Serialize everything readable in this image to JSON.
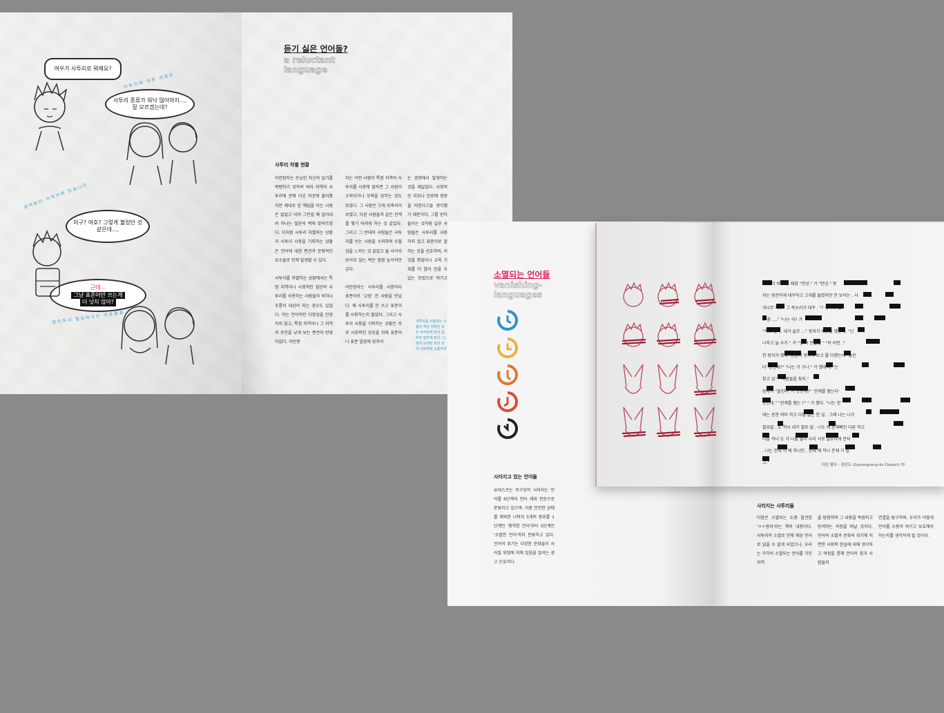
{
  "spread1": {
    "bubbles": {
      "q1": "여우가 사투리로 뭐예요?",
      "q2": "사투리 종류가 워낙 많아야지..., 잘 모르겠는데?",
      "q3": "미구? 여호? 그렇게 불렀던 것 같은데...,",
      "q4_red": "근데...",
      "q4_l1": "그냥 표준어만 쓰는게",
      "q4_l2": "더 낫지 않아?"
    },
    "arcs": {
      "a1": "사투리에 대한 의문은",
      "a2": "생각보다 가까이에 있습니다",
      "a3": "알아둬서 필요하다는 이유들을..."
    },
    "title": "듣기 싫은 언어들?",
    "subtitle": "a reluctant language",
    "section_heading": "사투리 차별 현황",
    "col1_p1": "어린왕자는 손님인 자신의 일기를 북펜하기 위하여 여러 지역의 사투리에 관해 이곳 저곳에 물어봤지만 제대로 된 해답을 아는 사람은 없었고 되려 그런걸 왜 알아내려 하냐는 질문의 벽에 맞닥뜨렸다. 이처럼 사투리 차별하는 상황과 사투리 사용을 기피하는 상황은 언어에 대한 편견과 문화적인 요소들로 인해 발생할 수 있다.",
    "col1_p2": "사투리를 차별하는 상황에서는 특정 지역이나 사회적인 집단의 사투리를 사용하는 사람들이 비하나 조롱의 대상이 되는 경우도 있었다. 이는 언어적인 다양성을 인정하지 않고, 특정 지역이나 그 지역의 주민을 낮게 보는 편견의 반영이었다. 어린왕",
    "col2_p1": "자는 어떤 사람이 특정 지역의 사투리를 사용해 말하면 그 사람이 소외되거나 모욕을 당하는 것도 보았다. 그 사람은 크게 위축되어 보였고, 다른 사람들과 같은 관계를 맺기 어려워 하는 것 같았다. 그리고 그 반대의 사람들은 사투리를 쓰는 사람을 소외하며 우월감을 느끼는 것 같았고 둘 사이의 보이지 않는 벽은 점점 높아져만 갔다.",
    "col2_p2": "어린왕자는 사투리를 사용하다 표준어로 '교정' 한 사람을 만났다. 왜 사투리를 안 쓰고 표준어를 사용하는지 물었다. 그리고 사투리 사용을 기피하는 상황은 주로 사회적인 상승을 위해 표준어나 표준 발음에 맞추어",
    "col3_p1": "는 경향에서 발생하는 것을 깨달았다. 사회적인 지위나 진로에 영향을 미친다고들 생각했기 때문이다. 그를 받아들이는 것처럼 일부 사람들은 사투리를 사용하지 않고 표준어로 말하는 것을 선호하며, 이것을 취업이나 교육 기회를 더 많이 얻을 수 있는 방법으로 여기고 있었다. 하지만 이러한 사투리 사용을 기피하는 상황이 지속될수록 언어적 다양성은 손상되어버린다.",
    "note": "사투리를 사용하는 사람이 적은 지역은 모두 주저하게 되어 실 자주 말하게 된다. 그래서 오래된 외의 생각 의외하며 조롱하게 되어 대로 를 사라는 높의 정석이다."
  },
  "spread2": {
    "title": "소멸되는 언어들",
    "subtitle": "vanishing-languages",
    "icons": [
      "clock-blue",
      "clock-yellow",
      "clock-orange",
      "clock-red",
      "clock-black"
    ],
    "icon_colors": [
      "#2f8fd0",
      "#e8b23a",
      "#e0782f",
      "#d94a3a",
      "#222222"
    ],
    "section1_heading": "사라지고 있는 언어들",
    "section1_body": "유네스코는 지구상의 사라지는 언어를 6단계의 언어 세대 전승으로 분류하고 있으며, 이중 안전한 상태를 제외한 나머지 5개의 층위를 1단계인 '취약한 언어'부터 5단계인 '소멸한 언어'까지 분류하고 있다. 언어의 위기는 다양한 문화들이 사라질 위험에 처해 있음을 알리는 경고 신호이다.",
    "section2_heading": "사라지는 사투리들",
    "section2_col1": "다음은 소멸되는 도중 발견된 'ㅇㅇ왕자'라는 책의 내용이다. 사투리의 소멸로 인해 해당 언어로 읽을 수 없게 되었으나, 우리는 각각의 소멸되는 언어를 가진 지역",
    "section2_col2": "을 탐험하며 그 내용을 복원하고 방색하는 여정을 떠날 것이다. 언어의 소멸과 문화의 위기에 직면한 사회적 현실에 대해 생각하고 여정을 통해 언어의 힘과 사람들의",
    "section2_col3": "연결을 탐구하며, 우리가 어떻게 언어를 소중히 여기고 보호해야 하는지를 생각하게 될 것이다.",
    "redacted_lines": [
      "가 나타 바로 그 때였 \"안녕.\" 가 \"안녕.\" 왕",
      "자는 왕전하게 대꾸하고 고개를 돌렸지만 안 보이는 . 사",
      "과나무 아...\" 그 목소리가 대꾸 . \"? 왕자가 했",
      ". \"참 ....\" \"나는 라? 가",
      "\"하고 놀자. 내가 슬프 ...\" 왕자가 제안을 했는데. \"난",
      "니하고 놀 수가 \" 가 \"난 이 안들었 \" \"아 미안 .\"",
      "한 왕자가 했다. 곰곰이 생각해 보고 를 더했는데 \"들인",
      "다' 뜻인데?\" \"나는 가 구나.\" 가 했데이. \"는",
      "찾고 있\" \" 사람들을 찾지.\"",
      "왕자가 \"들인다' 기 뜻인데?\" '관계를 맺는다'",
      "뜻인데.\" \"관계를 맺는 ?\" \" 가 했다. \"나는 한",
      "테는 흔한 여러 하고 다를 없는 한 일 . 그래 나는 니가",
      "필요없 . 도 역시 내가 필요 없 . 나도 에 흔해빠진 다른 하고",
      "다를 하나 도 가 나를 들이 우리 서로 필요하게 만되",
      ". 나는 한테 이 에 하나인 , 한테 에 하나 존재 가 될",
      "고.\""
    ],
    "caption": "어린 왕자 - 경상도 (Gyeongsang-do Dialect) 中"
  }
}
